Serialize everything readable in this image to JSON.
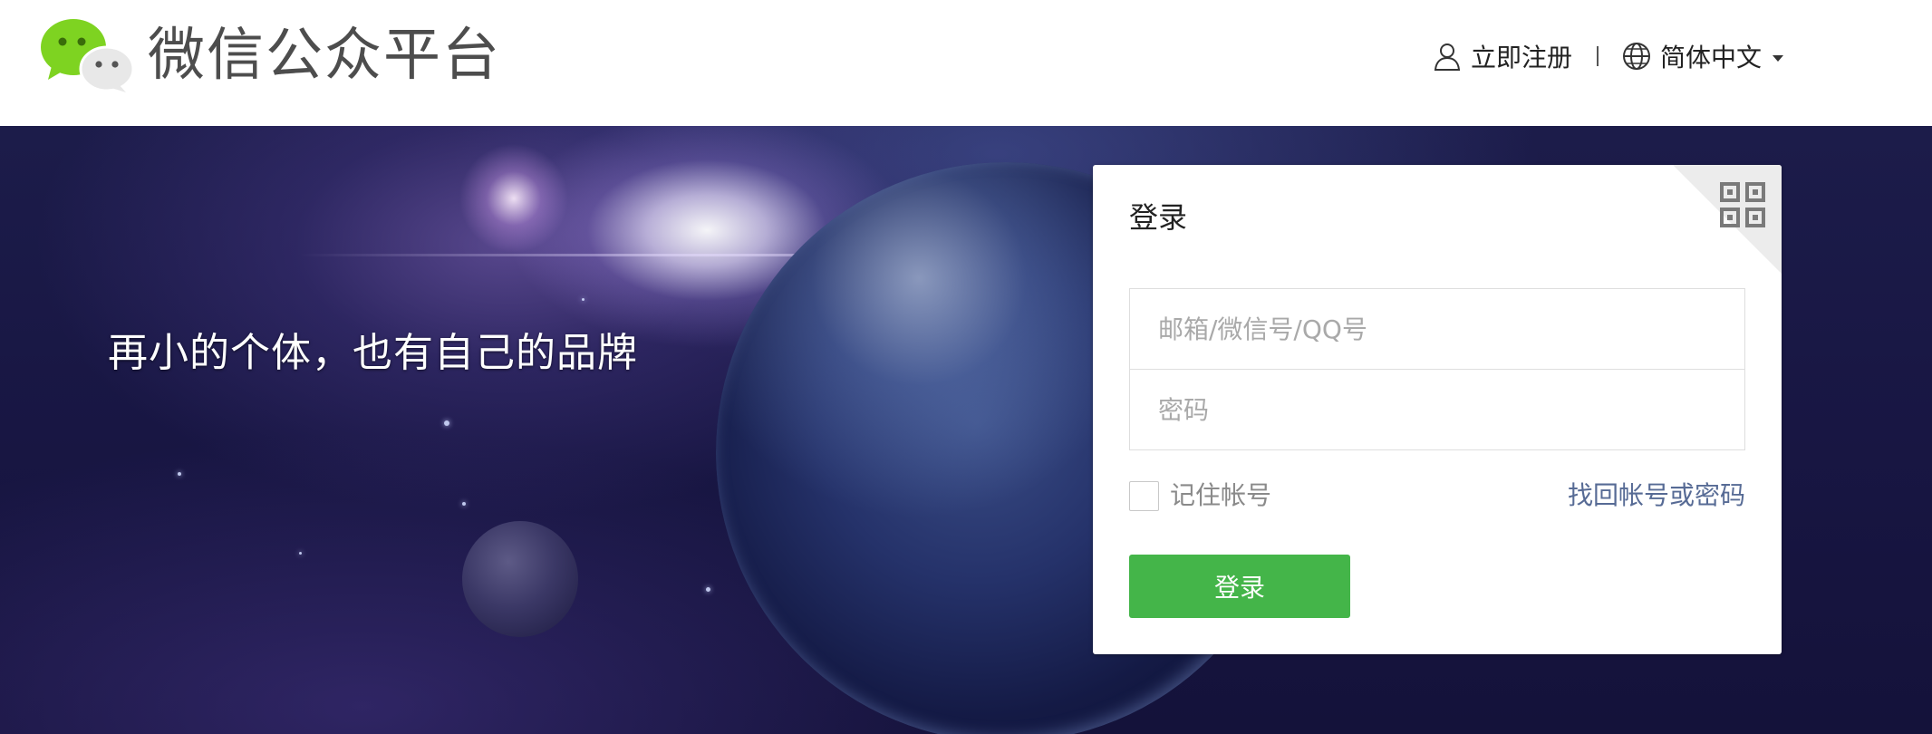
{
  "header": {
    "logo_icon": "wechat-logo-icon",
    "brand_title": "微信公众平台",
    "register_icon": "user-icon",
    "register_label": "立即注册",
    "language_icon": "globe-icon",
    "language_label": "简体中文",
    "language_caret_icon": "caret-down-icon"
  },
  "banner": {
    "slogan": "再小的个体，也有自己的品牌"
  },
  "login": {
    "title": "登录",
    "qr_icon": "qr-code-icon",
    "account_placeholder": "邮箱/微信号/QQ号",
    "account_value": "",
    "password_placeholder": "密码",
    "password_value": "",
    "remember_label": "记住帐号",
    "remember_checked": false,
    "forgot_link": "找回帐号或密码",
    "submit_label": "登录"
  },
  "colors": {
    "brand_green": "#44b549",
    "link_blue": "#576b95",
    "logo_green": "#7ed321"
  }
}
